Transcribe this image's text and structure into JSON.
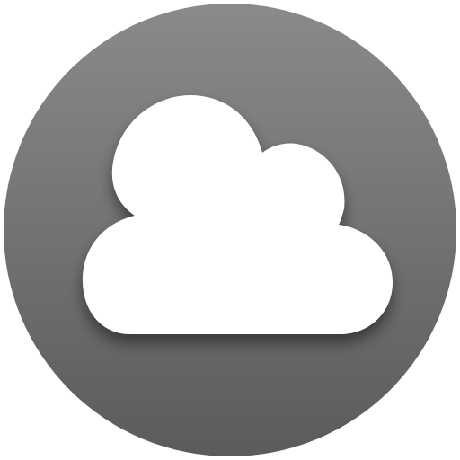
{
  "icon": {
    "name": "cloud-icon",
    "shape": "circle",
    "colors": {
      "disc_top": "#8a8a8a",
      "disc_bottom": "#5b5b5b",
      "cloud": "#ffffff",
      "shadow": "#2a2a2a"
    }
  }
}
